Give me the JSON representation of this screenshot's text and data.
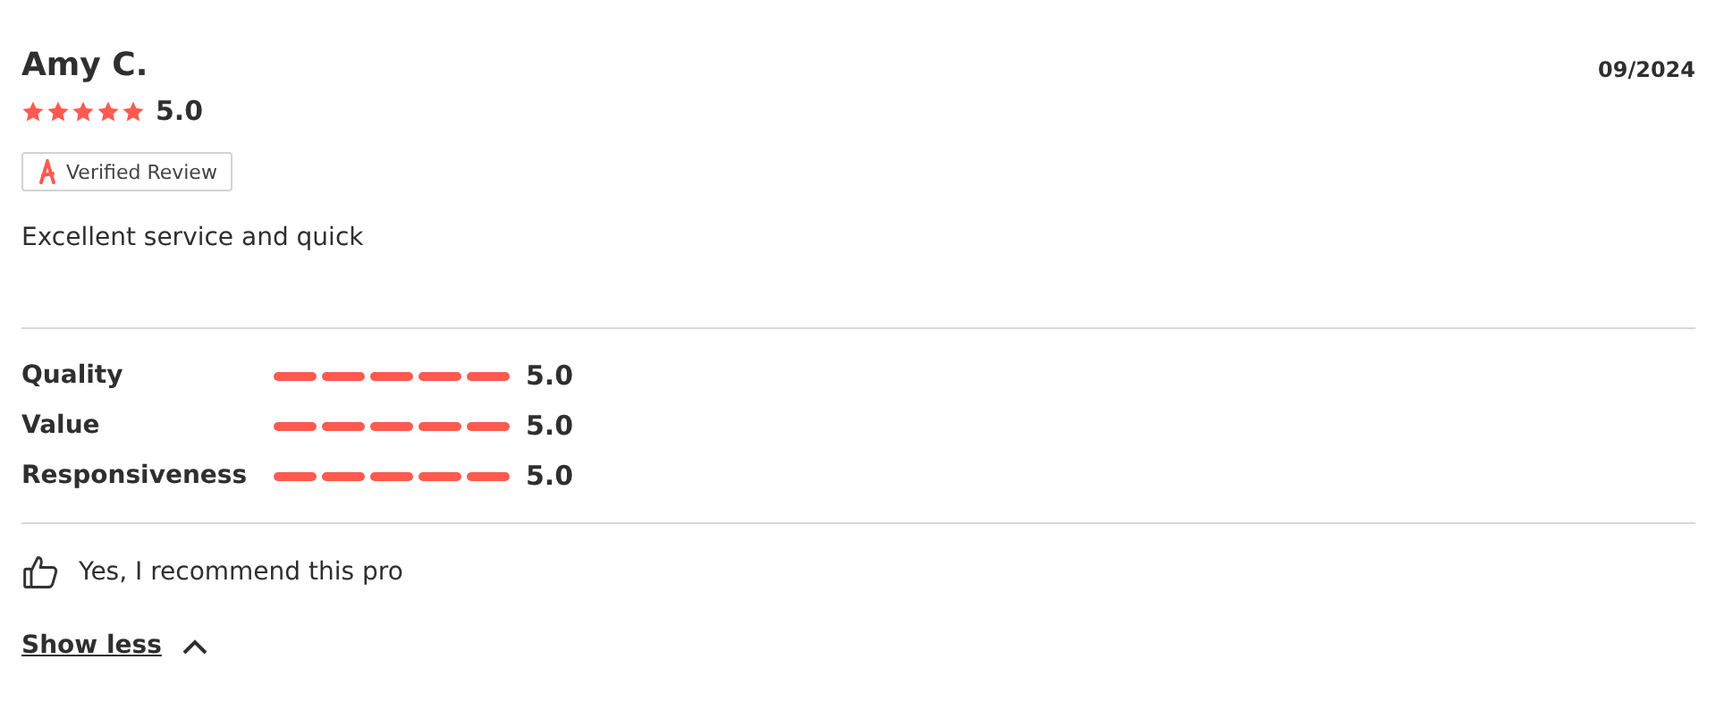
{
  "review": {
    "author": "Amy C.",
    "date": "09/2024",
    "stars": 5,
    "rating": "5.0",
    "badge": "Verified Review",
    "text": "Excellent service and quick"
  },
  "criteria": [
    {
      "label": "Quality",
      "stars": 5,
      "rating": "5.0"
    },
    {
      "label": "Value",
      "stars": 5,
      "rating": "5.0"
    },
    {
      "label": "Responsiveness",
      "stars": 5,
      "rating": "5.0"
    }
  ],
  "recommendation": {
    "recommended": true,
    "text": "Yes, I recommend this pro"
  },
  "toggle": {
    "label": "Show less",
    "expanded": true
  }
}
